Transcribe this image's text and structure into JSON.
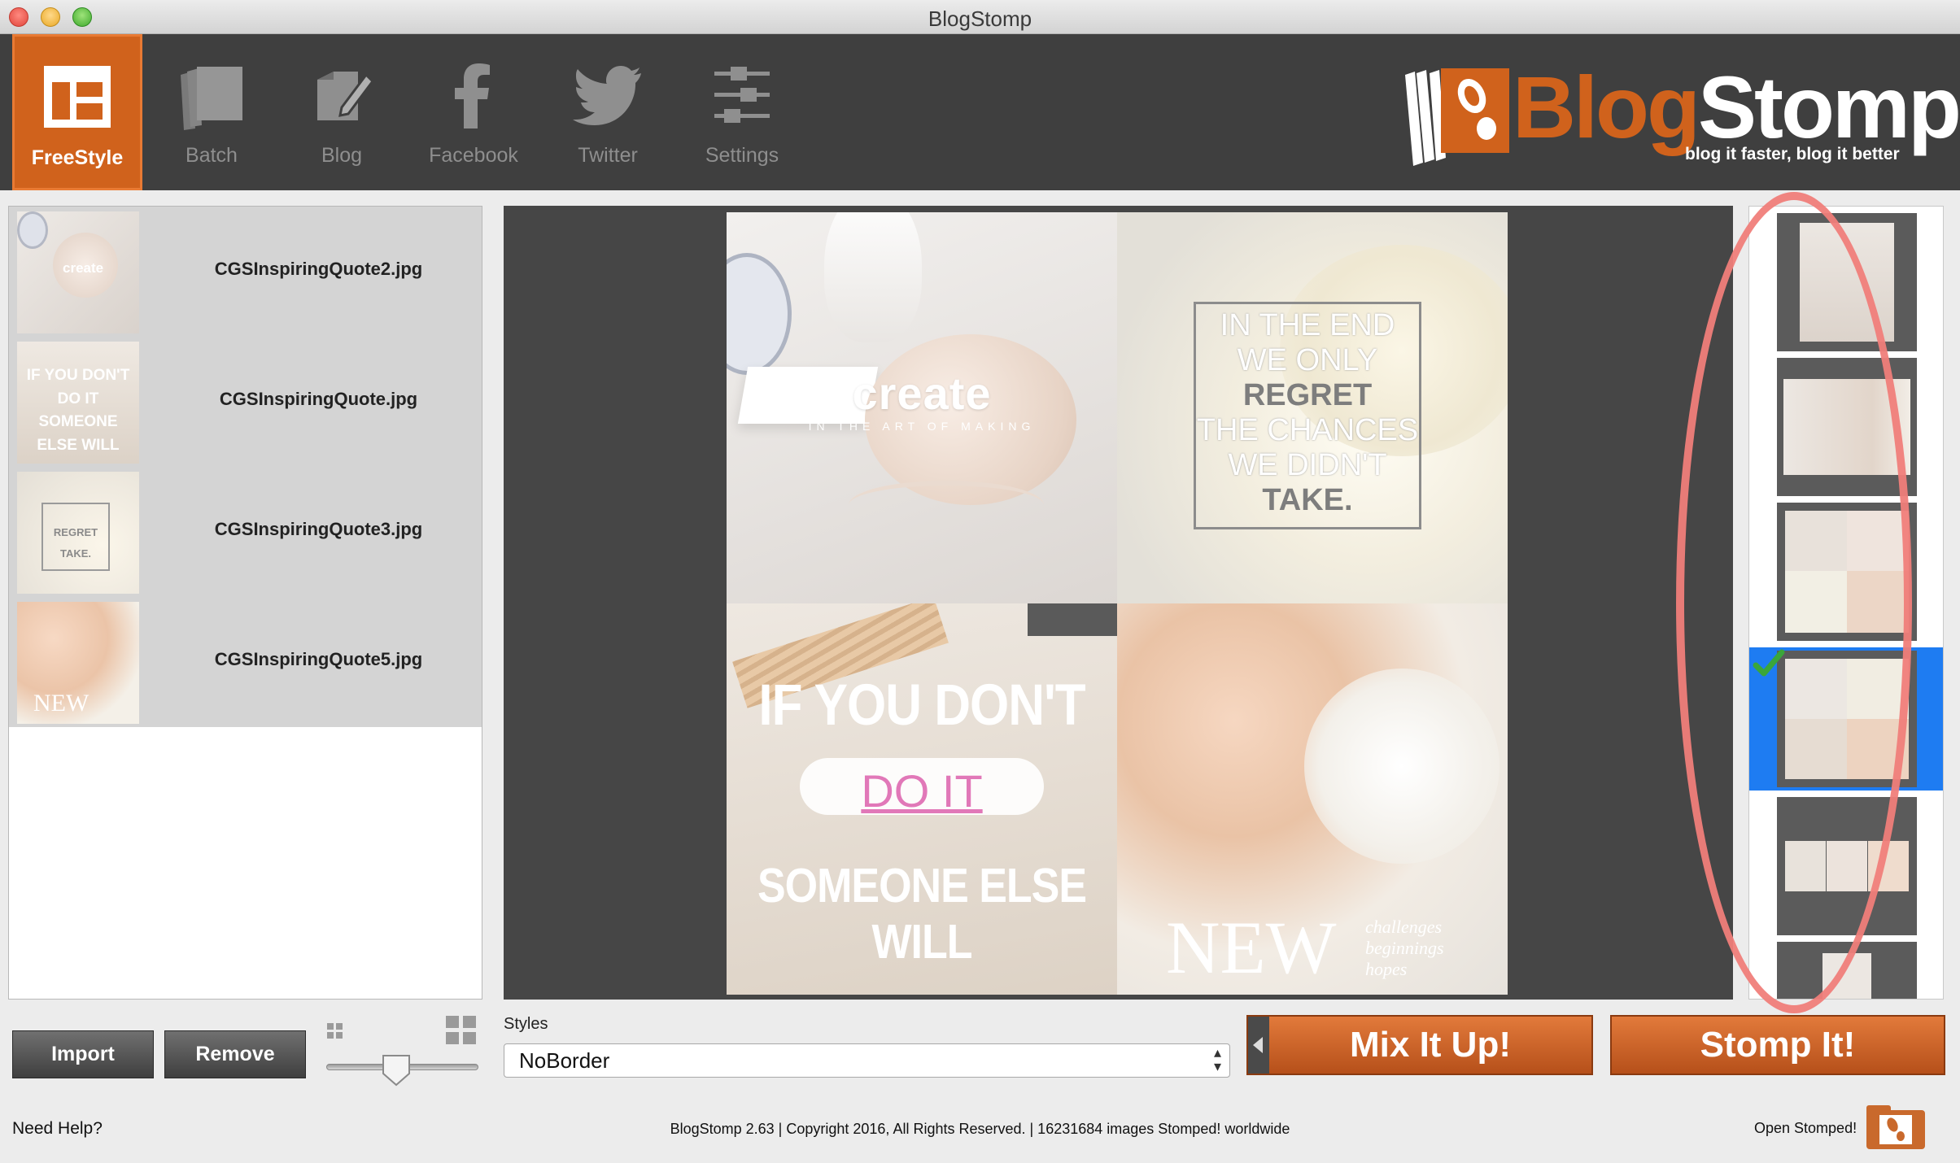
{
  "window": {
    "title": "BlogStomp"
  },
  "toolbar": {
    "tools": [
      {
        "label": "FreeStyle",
        "icon": "freestyle-layout-icon",
        "active": true
      },
      {
        "label": "Batch",
        "icon": "batch-stack-icon"
      },
      {
        "label": "Blog",
        "icon": "blog-pencil-icon"
      },
      {
        "label": "Facebook",
        "icon": "facebook-icon"
      },
      {
        "label": "Twitter",
        "icon": "twitter-bird-icon"
      },
      {
        "label": "Settings",
        "icon": "settings-sliders-icon"
      }
    ]
  },
  "brand": {
    "word_blog": "Blog",
    "word_stomp": "Stomp",
    "tagline": "blog it faster, blog it better"
  },
  "files": [
    {
      "name": "CGSInspiringQuote2.jpg",
      "thumb_text": "create"
    },
    {
      "name": "CGSInspiringQuote.jpg",
      "thumb_text": "IF YOU DON'T DO IT SOMEONE ELSE WILL"
    },
    {
      "name": "CGSInspiringQuote3.jpg",
      "thumb_text": "REGRET TAKE."
    },
    {
      "name": "CGSInspiringQuote5.jpg",
      "thumb_text": "NEW"
    }
  ],
  "collage": {
    "tile1": {
      "word": "create",
      "sub": "IN THE ART OF MAKING"
    },
    "tile2": {
      "lines": [
        "IN THE END",
        "WE ONLY",
        "REGRET",
        "THE CHANCES",
        "WE DIDN'T",
        "TAKE."
      ]
    },
    "tile3": {
      "line1": "IF YOU DON'T",
      "line2": "DO IT",
      "line3": "SOMEONE ELSE WILL"
    },
    "tile4": {
      "word": "NEW",
      "sub": [
        "challenges",
        "beginnings",
        "hopes"
      ]
    }
  },
  "controls": {
    "import_label": "Import",
    "remove_label": "Remove",
    "size_slider_value": 0.45,
    "styles_label": "Styles",
    "styles_selected": "NoBorder",
    "mix_label": "Mix It Up!",
    "stomp_label": "Stomp It!"
  },
  "footer": {
    "help": "Need Help?",
    "copyright": "BlogStomp 2.63 | Copyright 2016, All Rights Reserved. | 16231684 images Stomped! worldwide",
    "open_label": "Open Stomped!"
  },
  "colors": {
    "accent": "#d0621c",
    "toolbar_bg": "#3f3f3f",
    "selection": "#1e7cf2",
    "highlight_ring": "#f07e7a"
  },
  "layouts": {
    "count": 6,
    "selected_index": 3
  }
}
